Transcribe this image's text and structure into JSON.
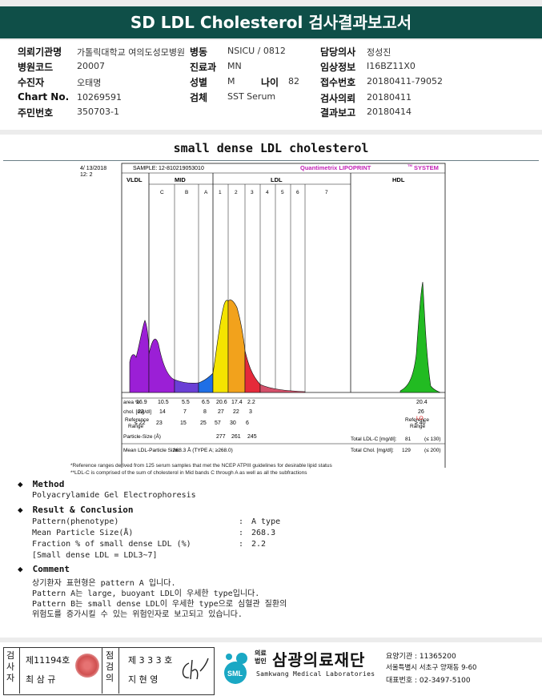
{
  "header": {
    "title": "SD LDL Cholesterol 검사결과보고서"
  },
  "info": {
    "fields": [
      {
        "label": "의뢰기관명",
        "value": "가톨릭대학교 여의도성모병원"
      },
      {
        "label": "병동",
        "value": "NSICU / 0812"
      },
      {
        "label": "담당의사",
        "value": "정성진"
      },
      {
        "label": "병원코드",
        "value": "20007"
      },
      {
        "label": "진료과",
        "value": "MN"
      },
      {
        "label": "임상정보",
        "value": "I16BZ11X0"
      },
      {
        "label": "수진자",
        "value": "오태명"
      },
      {
        "label": "성별",
        "value": "M"
      },
      {
        "label": "나이",
        "value": "82"
      },
      {
        "label": "접수번호",
        "value": "20180411-79052"
      },
      {
        "label": "Chart No.",
        "value": "10269591"
      },
      {
        "label": "검체",
        "value": "SST Serum"
      },
      {
        "label": "검사의뢰",
        "value": "20180411"
      },
      {
        "label": "주민번호",
        "value": "350703-1"
      },
      {
        "label": "결과보고",
        "value": "20180414"
      }
    ]
  },
  "report": {
    "title": "small dense LDL cholesterol",
    "footnote1": "*Reference ranges derived from 125 serum samples that met the NCEP ATPIII guidelines for desirable lipid status",
    "footnote2": "**LDL-C is comprised of the sum of cholesterol in Mid bands C through A as well as all the subfractions",
    "method_heading": "Method",
    "method_text": "Polyacrylamide Gel Electrophoresis",
    "result_heading": "Result & Conclusion",
    "result_rows": [
      {
        "label": "Pattern(phenotype)",
        "sep": ":",
        "value": "A type"
      },
      {
        "label": "Mean Particle Size(Å)",
        "sep": ":",
        "value": "268.3"
      },
      {
        "label": "Fraction % of small dense LDL (%)",
        "sep": ":",
        "value": "2.2"
      },
      {
        "label": "[Small dense LDL = LDL3~7]",
        "sep": "",
        "value": ""
      }
    ],
    "comment_heading": "Comment",
    "comment_lines": [
      "상기환자 표현형은 pattern A 입니다.",
      "Pattern A는 large, buoyant LDL이 우세한 type입니다.",
      "Pattern B는 small dense LDL이 우세한 type으로 심혈관 질환의",
      "위험도를 증가시킬 수 있는 위험인자로 보고되고 있습니다."
    ]
  },
  "chart_data": {
    "type": "area",
    "header_date": "4/ 13/2018",
    "header_time": "12: 2",
    "sample_label": "SAMPLE:",
    "sample_id": "12-810219053010",
    "brand": "Quantimetrix LIPOPRINT",
    "brand_tm": "TM",
    "brand_suffix": "SYSTEM",
    "bands": [
      "VLDL",
      "C",
      "B",
      "A",
      "1",
      "2",
      "3",
      "4",
      "5",
      "6",
      "7"
    ],
    "groups": [
      "VLDL",
      "MID",
      "LDL",
      "HDL"
    ],
    "band_labels": [
      "C",
      "B",
      "A",
      "1",
      "2",
      "3",
      "4",
      "5",
      "6",
      "7"
    ],
    "area_label": "area %",
    "area_values": [
      "16.9",
      "10.5",
      "5.5",
      "6.5",
      "20.6",
      "17.4",
      "2.2",
      "",
      "",
      "",
      "",
      "20.4"
    ],
    "chol_label": "chol. [mg/dl]",
    "chol_values": [
      "22",
      "14",
      "7",
      "8",
      "27",
      "22",
      "3",
      "",
      "",
      "",
      "",
      "26"
    ],
    "chol_flag": "LO",
    "ref_label": "Reference Range",
    "ref_values": [
      "≤ 22",
      "23",
      "15",
      "25",
      "57",
      "30",
      "6",
      "",
      "",
      "",
      "",
      "≥ 40"
    ],
    "ref_label_right": "Reference Range",
    "particle_label": "Particle-Size (Å)",
    "particle_values": [
      "",
      "",
      "",
      "",
      "277",
      "261",
      "245"
    ],
    "mean_label": "Mean LDL-Particle Size:",
    "mean_value": "268.3 Å (TYPE A; ≥268.0)",
    "total_ldl_label": "Total LDL-C [mg/dl]:",
    "total_ldl_value": "81",
    "total_ldl_ref": "(≤ 130)",
    "total_chol_label": "Total Chol. [mg/dl]:",
    "total_chol_value": "129",
    "total_chol_ref": "(≤ 200)",
    "colors": {
      "vldl": "#9b1fd6",
      "mid": "#6a3fd6",
      "midA": "#1f6fe6",
      "ldl1": "#f4e400",
      "ldl2": "#f2a21c",
      "ldl3": "#e52a3a",
      "hdl": "#22bb22"
    }
  },
  "footer": {
    "inspector_label": "검사자",
    "inspector_id": "제11194호",
    "inspector_name": "최 삼 규",
    "reviewer_label": "점검의",
    "reviewer_id": "제 3 3 3 호",
    "reviewer_name": "지 현 영",
    "org_prefix_1": "의료",
    "org_prefix_2": "법인",
    "org_name": "삼광의료재단",
    "org_english": "Samkwang Medical Laboratories",
    "logo_text": "SML",
    "code_label": "요양기관 : 11365200",
    "address": "서울특별시 서초구 양재동 9-60",
    "phone": "대표번호 : 02-3497-5100"
  }
}
